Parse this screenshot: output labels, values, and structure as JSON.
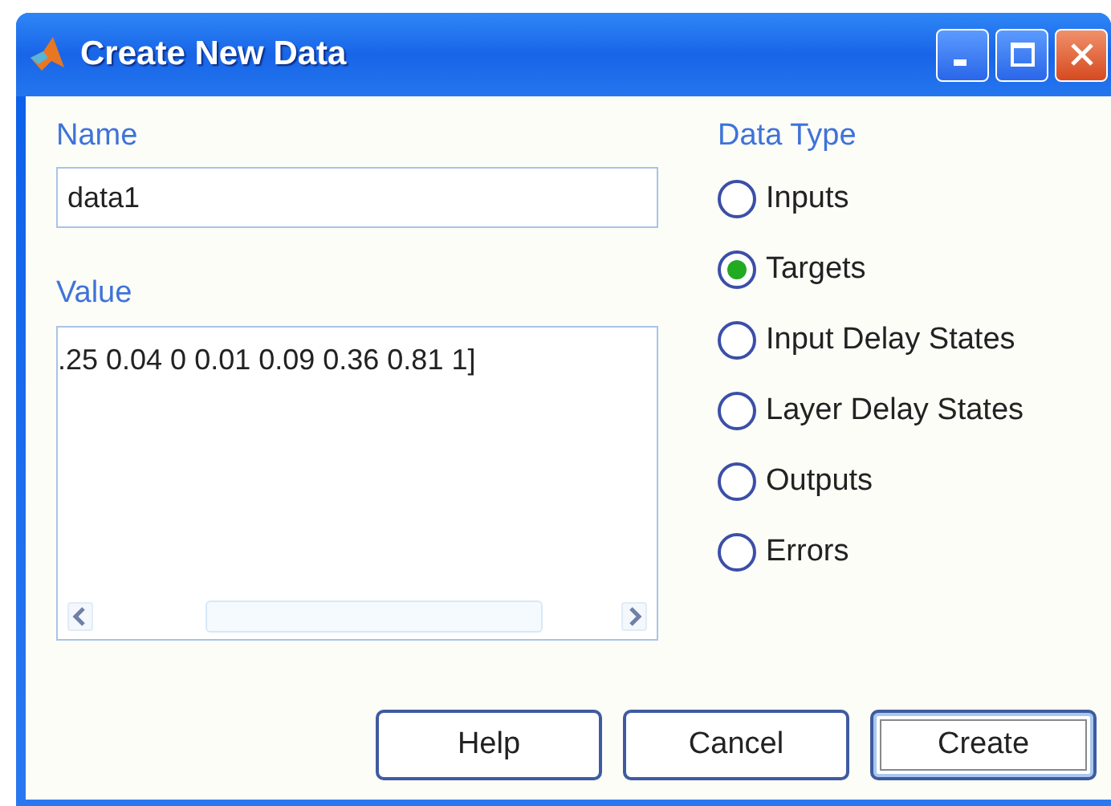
{
  "window": {
    "title": "Create New Data"
  },
  "name": {
    "label": "Name",
    "value": "data1"
  },
  "value": {
    "label": "Value",
    "value": ".25 0.04 0 0.01 0.09 0.36 0.81 1]"
  },
  "data_type": {
    "label": "Data Type",
    "options": [
      {
        "label": "Inputs",
        "selected": false
      },
      {
        "label": "Targets",
        "selected": true
      },
      {
        "label": "Input Delay States",
        "selected": false
      },
      {
        "label": "Layer Delay States",
        "selected": false
      },
      {
        "label": "Outputs",
        "selected": false
      },
      {
        "label": "Errors",
        "selected": false
      }
    ]
  },
  "buttons": [
    {
      "label": "Help",
      "default": false
    },
    {
      "label": "Cancel",
      "default": false
    },
    {
      "label": "Create",
      "default": true
    }
  ]
}
